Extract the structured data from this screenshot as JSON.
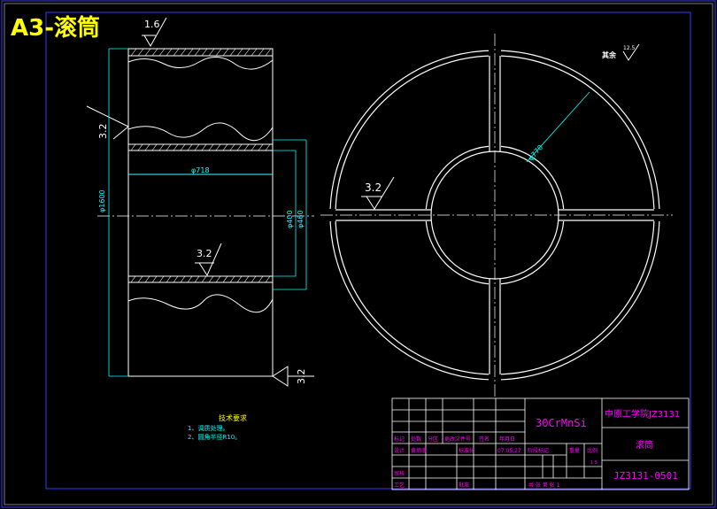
{
  "sheet": {
    "title": "A3-滚筒",
    "title_color": "#FFFF00"
  },
  "colors": {
    "line": "#FFFFFF",
    "dimension": "#00FFFF",
    "frame": "#3A3AFF",
    "annotation": "#FFFF00",
    "table_text": "#FF00FF",
    "dim_text": "#00FFFF"
  },
  "side_view": {
    "roughness_top": "1.6",
    "roughness_left": "3.2",
    "roughness_bore": "3.2",
    "roughness_right": "3.2",
    "dims": {
      "outer_dia": "φ1600",
      "bore_dia": "φ718",
      "inner1": "φ400",
      "inner2": "φ460"
    }
  },
  "front_view": {
    "roughness_spoke": "3.2",
    "radius_dim": "φ770",
    "other_label": "其余",
    "other_roughness": "12.5"
  },
  "tech_requirements": {
    "heading": "技术要求",
    "items": [
      "1、调质处理。",
      "2、圆角半径R10。"
    ]
  },
  "title_block": {
    "material": "30CrMnSi",
    "school": "中原工学院JZ3131",
    "part_name": "滚筒",
    "drawing_no": "JZ3131-0501",
    "row_headers": [
      "标记",
      "处数",
      "分区",
      "更改文件号",
      "签名",
      "年月日"
    ],
    "design_label": "设计",
    "designer": "黄炳南",
    "std_label": "标准化",
    "date": "07.05.27",
    "stage_label": "阶段标记",
    "weight_label": "重量",
    "scale_label": "比例",
    "scale_value": "1:5",
    "review_label": "审核",
    "process_label": "工艺",
    "approve_label": "批准",
    "sheets_text": "共  张 第  张  1"
  }
}
